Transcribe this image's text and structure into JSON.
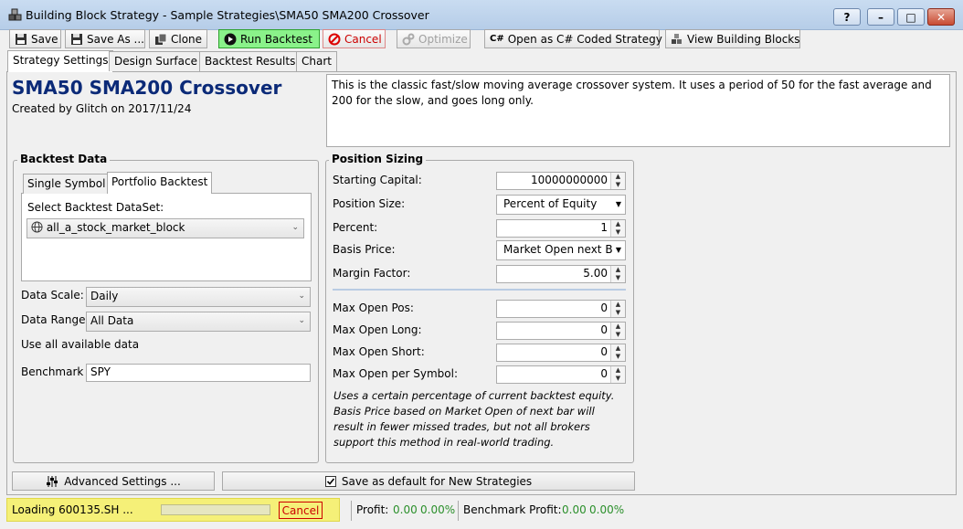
{
  "window": {
    "title": "Building Block Strategy - Sample Strategies\\SMA50 SMA200 Crossover",
    "help_label": "?",
    "min_label": "–",
    "max_label": "□",
    "close_label": "✕"
  },
  "toolbar": {
    "save": "Save",
    "save_as": "Save As ...",
    "clone": "Clone",
    "run_backtest": "Run Backtest",
    "cancel": "Cancel",
    "optimize": "Optimize",
    "open_csharp": "Open as C# Coded Strategy",
    "view_blocks": "View Building Blocks",
    "csharp_glyph": "C#"
  },
  "tabs": [
    "Strategy Settings",
    "Design Surface",
    "Backtest Results",
    "Chart"
  ],
  "strategy": {
    "name": "SMA50 SMA200 Crossover",
    "author_line": "Created by Glitch on 2017/11/24",
    "description": "This is the classic fast/slow moving average crossover system. It uses a period of 50 for the fast average and 200 for the slow, and goes long only."
  },
  "backtest_data": {
    "title": "Backtest Data",
    "tabs": [
      "Single Symbol",
      "Portfolio Backtest"
    ],
    "dataset_label": "Select Backtest DataSet:",
    "dataset_value": "all_a_stock_market_block",
    "scale_label": "Data Scale:",
    "scale_value": "Daily",
    "range_label": "Data Range",
    "range_value": "All Data",
    "range_note": "Use all available data",
    "benchmark_label": "Benchmark",
    "benchmark_value": "SPY"
  },
  "position_sizing": {
    "title": "Position Sizing",
    "starting_capital_label": "Starting Capital:",
    "starting_capital_value": "10000000000",
    "position_size_label": "Position Size:",
    "position_size_value": "Percent of Equity",
    "percent_label": "Percent:",
    "percent_value": "1",
    "basis_price_label": "Basis Price:",
    "basis_price_value": "Market Open next B",
    "margin_factor_label": "Margin Factor:",
    "margin_factor_value": "5.00",
    "max_open_pos_label": "Max Open Pos:",
    "max_open_pos_value": "0",
    "max_open_long_label": "Max Open Long:",
    "max_open_long_value": "0",
    "max_open_short_label": "Max Open Short:",
    "max_open_short_value": "0",
    "max_open_per_symbol_label": "Max Open per Symbol:",
    "max_open_per_symbol_value": "0",
    "note": "Uses a certain percentage of current backtest equity. Basis Price based on Market Open of next bar will result in fewer missed trades, but not all brokers support this method in real-world trading."
  },
  "bottom": {
    "advanced_settings": "Advanced Settings ...",
    "save_default": "Save as default for New Strategies",
    "save_default_checked": true
  },
  "status": {
    "loading": "Loading 600135.SH ...",
    "progress": 0,
    "cancel": "Cancel",
    "profit_label": "Profit:",
    "profit_value": "0.00",
    "profit_pct": "0.00%",
    "benchmark_profit_label": "Benchmark Profit:",
    "benchmark_profit_value": "0.00",
    "benchmark_profit_pct": "0.00%"
  },
  "colors": {
    "title_text": "#0b2a78",
    "run_backtest_bg": "#8af28a",
    "cancel_red": "#cc0000",
    "status_highlight": "#f5f078",
    "profit_green": "#2a8f2a"
  },
  "icons": {
    "window": "blocks-icon",
    "save": "floppy-icon",
    "save_as": "floppy-icon",
    "clone": "clone-icon",
    "run": "play-icon",
    "cancel": "no-entry-icon",
    "optimize": "gears-icon",
    "open_csharp": "csharp-icon",
    "view_blocks": "blocks-icon",
    "dataset": "globe-icon",
    "advanced": "sliders-icon",
    "save_default": "checkbox-icon"
  }
}
